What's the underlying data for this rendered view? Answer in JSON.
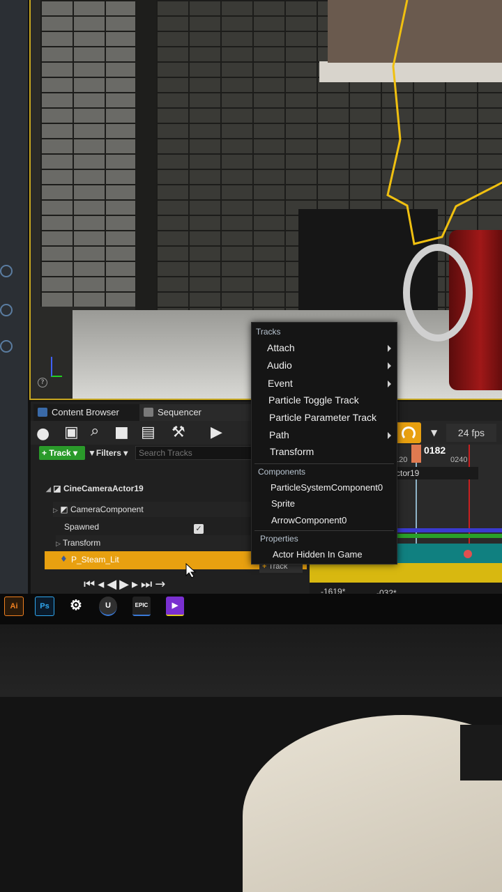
{
  "tabs": {
    "content_browser": "Content Browser",
    "sequencer": "Sequencer"
  },
  "toolbar": {
    "track_button": "Track",
    "filters_button": "Filters",
    "search_placeholder": "Search Tracks",
    "fps": "24 fps"
  },
  "outliner": {
    "actor": "CineCameraActor19",
    "component": "CameraComponent",
    "spawned": "Spawned",
    "transform": "Transform",
    "selected_track": "P_Steam_Lit",
    "add_track": "Track"
  },
  "timeline": {
    "frame_current": "0182",
    "frame_left": "120",
    "frame_right": "0240",
    "section_label": "ctor19",
    "range_start": "-1619",
    "range_end": "-032"
  },
  "context_menu": {
    "tracks_header": "Tracks",
    "track_items": [
      "Attach",
      "Audio",
      "Event",
      "Particle Toggle Track",
      "Particle Parameter Track",
      "Path",
      "Transform"
    ],
    "components_header": "Components",
    "component_items": [
      "ParticleSystemComponent0",
      "Sprite",
      "ArrowComponent0"
    ],
    "properties_header": "Properties",
    "property_items": [
      "Actor Hidden In Game"
    ]
  },
  "taskbar": {
    "illustrator": "Ai",
    "photoshop": "Ps",
    "epic": "EPIC"
  },
  "colors": {
    "accent_green": "#2a9a2a",
    "selection_orange": "#e8a010",
    "viewport_border": "#e8c020",
    "menu_bg": "#151515"
  }
}
